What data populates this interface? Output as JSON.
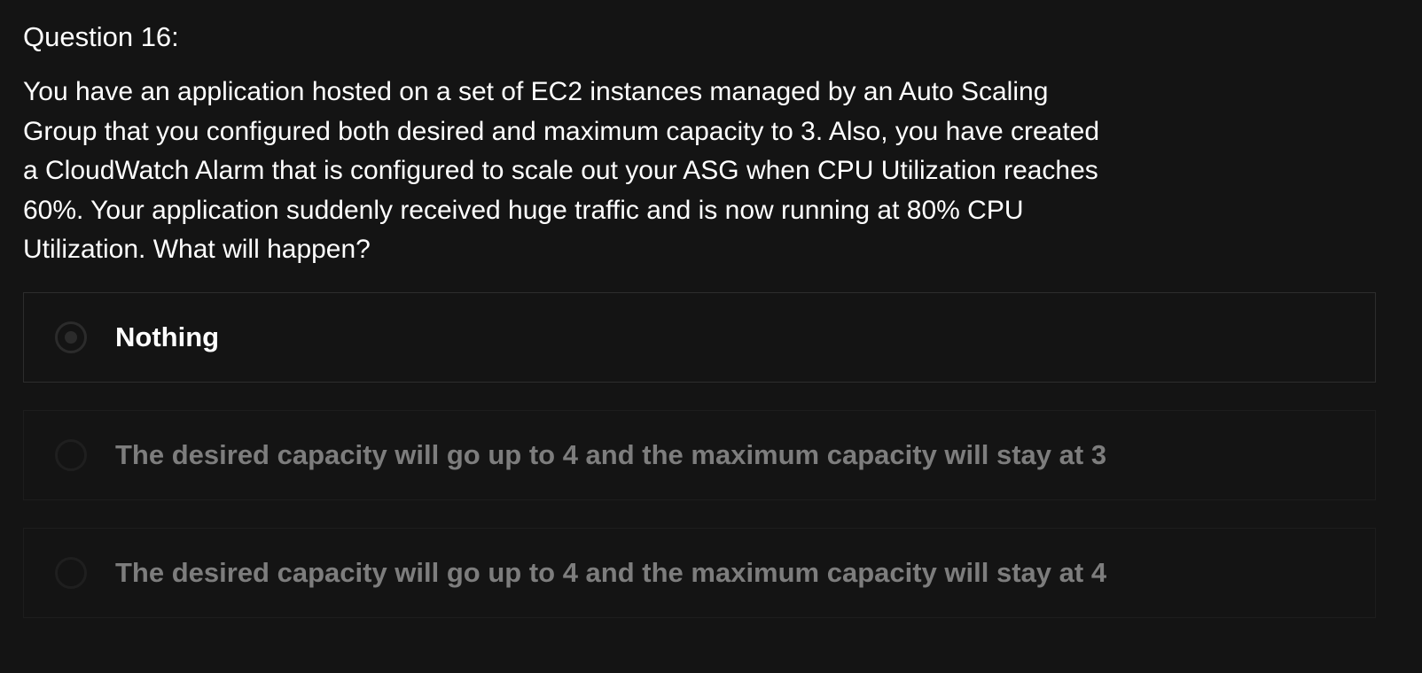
{
  "question": {
    "number_label": "Question 16:",
    "text": "You have an application hosted on a set of EC2 instances managed by an Auto Scaling Group that you configured both desired and maximum capacity to 3. Also, you have created a CloudWatch Alarm that is configured to scale out your ASG when CPU Utilization reaches 60%. Your application suddenly received huge traffic and is now running at 80% CPU Utilization. What will happen?"
  },
  "options": [
    {
      "label": "Nothing",
      "state": "selected"
    },
    {
      "label": "The desired capacity will go up to 4 and the maximum capacity will stay at 3",
      "state": "unselected"
    },
    {
      "label": "The desired capacity will go up to 4 and the maximum capacity will stay at 4",
      "state": "unselected"
    }
  ],
  "colors": {
    "background": "#141414",
    "text": "#ffffff",
    "dim_text": "#7d7d7d",
    "border": "#262626"
  }
}
